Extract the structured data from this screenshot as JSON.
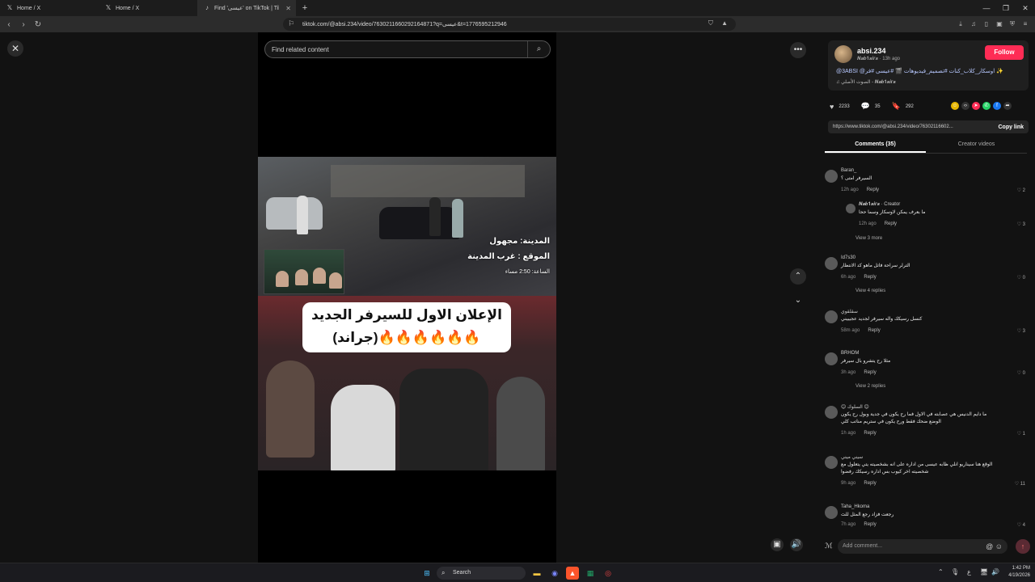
{
  "browser": {
    "tabs": [
      {
        "label": "Home / X",
        "icon": "X"
      },
      {
        "label": "Home / X",
        "icon": "X"
      },
      {
        "label": "Find 'عيسى' on TikTok | TikTok",
        "icon": "tiktok"
      }
    ],
    "url": "tiktok.com/@absi.234/video/7630211660292164871?q=عيسى&t=1776595212946"
  },
  "search": {
    "placeholder": "Find related content"
  },
  "video": {
    "overlay_lines": [
      "المدينة: مجهول",
      "الموقع : غرب المدينة",
      "الساعة: 2:50 مساء"
    ],
    "bubble_line1": "الإعلان الاول للسيرفر الجديد",
    "bubble_line2": "(جراند)🔥🔥🔥🔥🔥🔥"
  },
  "author": {
    "username": "absi.234",
    "subtitle": "𝑵𝒂𝒃𝟏𝒔𝒊𝒓𝒔 · 13h ago",
    "follow_label": "Follow",
    "caption": "@3ABSI @اوسكار_كلاب_كنات #تصميم_فيديوهات 🎬 #عيسى #فر ✨",
    "music": "♫ الصوت الأصلي - 𝑵𝒂𝒃𝟏𝒔𝒊𝒓𝒔"
  },
  "stats": {
    "likes": "2233",
    "comments": "35",
    "saves": "292"
  },
  "link": {
    "url": "https://www.tiktok.com/@absi.234/video/76302116602...",
    "copy_label": "Copy link"
  },
  "tabs": {
    "comments": "Comments (35)",
    "creator": "Creator videos"
  },
  "comments": [
    {
      "name": "Baran_",
      "text": "السيرفر امتى ؟",
      "time": "12h ago",
      "reply": "Reply",
      "likes": "2"
    },
    {
      "name": "𝑵𝒂𝒃𝟏𝒔𝒊𝒓𝒔 · Creator",
      "text": "ما بعرف يمكن لاوسكار وسما ححا",
      "time": "12h ago",
      "reply": "Reply",
      "likes": "3"
    },
    {
      "name": "Id7s30",
      "text": "الترلر سراحة فاتل ماهو كد الانتظار",
      "time": "6h ago",
      "reply": "Reply",
      "likes": "0"
    },
    {
      "name": "سقلقوي",
      "text": "كنسل رسيكك واله سيرفر لجديد عجيبيني",
      "time": "58m ago",
      "reply": "Reply",
      "likes": "3"
    },
    {
      "name": "BRHOM",
      "text": "مثلا رح يتشرو بال سيرفر",
      "time": "3h ago",
      "reply": "Reply",
      "likes": "0"
    },
    {
      "name": "😊 السلوك 😊",
      "text": "ما دايم الدنيس هي عصابته في الاول فما رح يكون في جدية وبول رح يكون الوضع ضحك فقط ورح يكون في ستريم مناتب كلي",
      "time": "1h ago",
      "reply": "Reply",
      "likes": "1"
    },
    {
      "name": "سيني ميني",
      "text": "الوقع هنا سيناريو انلي ظابه عيسى من اداره على انه بشخصيته يتي يتعلول مع شخصيته اخر كيوب بس اداره رسيكك رفضوا",
      "time": "9h ago",
      "reply": "Reply",
      "likes": "11"
    },
    {
      "name": "Taha_Hkoma",
      "text": "رجعت فزاد رجع المثل للث",
      "time": "7h ago",
      "reply": "Reply",
      "likes": "4"
    }
  ],
  "view_more": [
    "View 3 more",
    "View 4 replies",
    "View 2 replies"
  ],
  "add_comment": {
    "placeholder": "Add comment..."
  },
  "taskbar": {
    "search": "Search",
    "time": "1:42 PM",
    "date": "4/19/2026",
    "lang": "ع"
  }
}
